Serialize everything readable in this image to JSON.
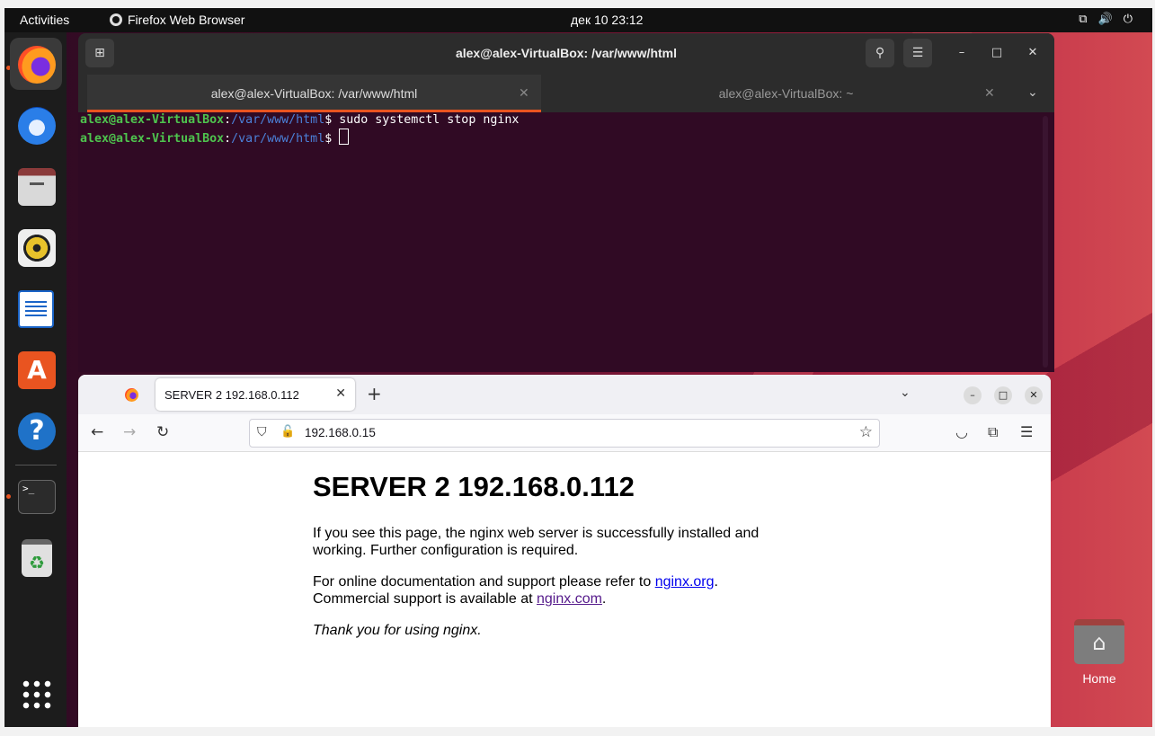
{
  "topbar": {
    "activities": "Activities",
    "app_name": "Firefox Web Browser",
    "clock": "дек 10  23:12",
    "icons": [
      "network-icon",
      "volume-icon",
      "power-icon"
    ]
  },
  "dock": {
    "items": [
      "firefox",
      "thunderbird",
      "files",
      "rhythmbox",
      "libreoffice-writer",
      "app-center",
      "help",
      "terminal",
      "trash"
    ],
    "apps_grid": "show-applications-icon"
  },
  "terminal": {
    "title": "alex@alex-VirtualBox: /var/www/html",
    "tabs": [
      {
        "label": "alex@alex-VirtualBox: /var/www/html",
        "active": true
      },
      {
        "label": "alex@alex-VirtualBox: ~",
        "active": false
      }
    ],
    "lines": [
      {
        "user": "alex@alex-VirtualBox",
        "sep": ":",
        "path": "/var/www/html",
        "prompt": "$ ",
        "cmd": "sudo systemctl stop nginx"
      },
      {
        "user": "alex@alex-VirtualBox",
        "sep": ":",
        "path": "/var/www/html",
        "prompt": "$ ",
        "cmd": ""
      }
    ]
  },
  "firefox": {
    "tab_title": "SERVER 2 192.168.0.112",
    "url": "192.168.0.15",
    "page": {
      "heading": "SERVER 2 192.168.0.112",
      "p1": "If you see this page, the nginx web server is successfully installed and working. Further configuration is required.",
      "p2_a": "For online documentation and support please refer to ",
      "p2_link1": "nginx.org",
      "p2_b": ".",
      "p2_c": "Commercial support is available at ",
      "p2_link2": "nginx.com",
      "p2_d": ".",
      "p3": "Thank you for using nginx."
    }
  },
  "desktop": {
    "home_label": "Home"
  },
  "colors": {
    "accent": "#e95420",
    "terminal_bg": "#300a24",
    "prompt_user": "#4ec44e",
    "prompt_path": "#4b80d8"
  }
}
